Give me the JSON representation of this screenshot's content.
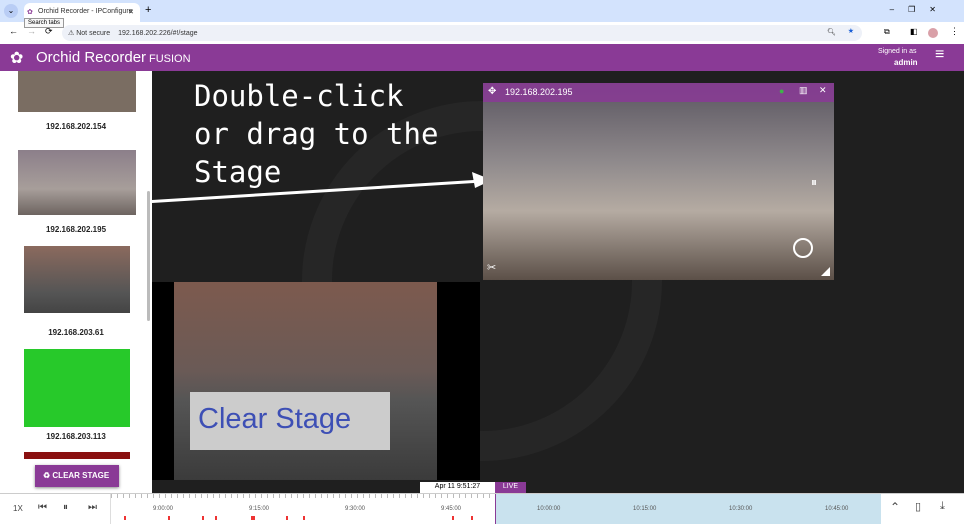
{
  "browser": {
    "tab_title": "Orchid Recorder - IPConfigure",
    "tooltip": "Search tabs",
    "security": "Not secure",
    "url": "192.168.202.226/#!/stage"
  },
  "app": {
    "name": "Orchid Recorder",
    "edition": "FUSION",
    "signed_in_label": "Signed in as",
    "user": "admin"
  },
  "sidebar": {
    "cameras": [
      {
        "label": "192.168.202.154"
      },
      {
        "label": "192.168.202.195"
      },
      {
        "label": "192.168.203.61"
      },
      {
        "label": "192.168.203.113"
      }
    ],
    "clear_stage": "CLEAR STAGE"
  },
  "stage": {
    "tile_title": "192.168.202.195",
    "annotation_drag": "Double-click or drag to the Stage",
    "annotation_clear": "Clear Stage"
  },
  "timeline": {
    "speed": "1X",
    "current_time": "Apr 11 9:51:27",
    "live": "LIVE",
    "ticks": [
      "9:00:00",
      "9:15:00",
      "9:30:00",
      "9:45:00",
      "10:00:00",
      "10:15:00",
      "10:30:00",
      "10:45:00"
    ]
  },
  "colors": {
    "brand": "#8a3a96",
    "annotation": "#3d4fb5",
    "future": "#c9e2ee"
  }
}
